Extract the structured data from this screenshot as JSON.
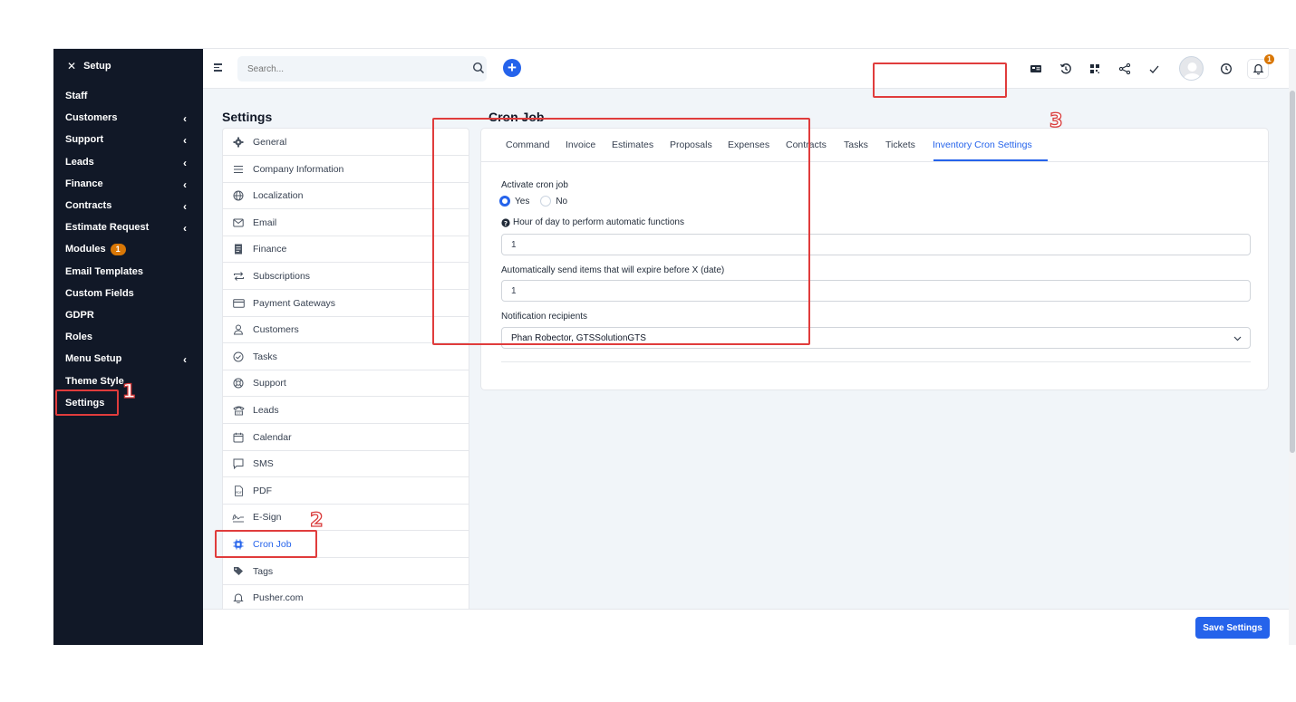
{
  "sidebar": {
    "header": "Setup",
    "items": [
      {
        "label": "Staff",
        "chevron": false
      },
      {
        "label": "Customers",
        "chevron": true
      },
      {
        "label": "Support",
        "chevron": true
      },
      {
        "label": "Leads",
        "chevron": true
      },
      {
        "label": "Finance",
        "chevron": true
      },
      {
        "label": "Contracts",
        "chevron": true
      },
      {
        "label": "Estimate Request",
        "chevron": true
      },
      {
        "label": "Modules",
        "chevron": false,
        "badge": "1"
      },
      {
        "label": "Email Templates",
        "chevron": false
      },
      {
        "label": "Custom Fields",
        "chevron": false
      },
      {
        "label": "GDPR",
        "chevron": false
      },
      {
        "label": "Roles",
        "chevron": false
      },
      {
        "label": "Menu Setup",
        "chevron": true
      },
      {
        "label": "Theme Style",
        "chevron": false
      },
      {
        "label": "Settings",
        "chevron": false,
        "highlighted": true
      }
    ]
  },
  "topbar": {
    "search_placeholder": "Search...",
    "notification_count": "1"
  },
  "settings": {
    "title": "Settings",
    "items": [
      {
        "label": "General",
        "icon": "gear-icon"
      },
      {
        "label": "Company Information",
        "icon": "lines-icon"
      },
      {
        "label": "Localization",
        "icon": "globe-icon"
      },
      {
        "label": "Email",
        "icon": "mail-icon"
      },
      {
        "label": "Finance",
        "icon": "document-icon"
      },
      {
        "label": "Subscriptions",
        "icon": "repeat-icon"
      },
      {
        "label": "Payment Gateways",
        "icon": "card-icon"
      },
      {
        "label": "Customers",
        "icon": "user-icon"
      },
      {
        "label": "Tasks",
        "icon": "check-circle-icon"
      },
      {
        "label": "Support",
        "icon": "lifebuoy-icon"
      },
      {
        "label": "Leads",
        "icon": "tty-icon"
      },
      {
        "label": "Calendar",
        "icon": "calendar-icon"
      },
      {
        "label": "SMS",
        "icon": "chat-icon"
      },
      {
        "label": "PDF",
        "icon": "pdf-icon"
      },
      {
        "label": "E-Sign",
        "icon": "signature-icon"
      },
      {
        "label": "Cron Job",
        "icon": "cpu-icon",
        "active": true
      },
      {
        "label": "Tags",
        "icon": "tag-icon"
      },
      {
        "label": "Pusher.com",
        "icon": "bell-icon"
      }
    ]
  },
  "cron": {
    "title": "Cron Job",
    "tabs": [
      "Command",
      "Invoice",
      "Estimates",
      "Proposals",
      "Expenses",
      "Contracts",
      "Tasks",
      "Tickets",
      "Inventory Cron Settings"
    ],
    "active_tab": "Inventory Cron Settings",
    "activate_label": "Activate cron job",
    "yes_label": "Yes",
    "no_label": "No",
    "activate_value": "Yes",
    "hour_label": "Hour of day to perform automatic functions",
    "hour_value": "1",
    "expire_label": "Automatically send items that will expire before X (date)",
    "expire_value": "1",
    "recipients_label": "Notification recipients",
    "recipients_value": "Phan Robector, GTSSolutionGTS"
  },
  "save_label": "Save Settings",
  "annotations": [
    "1",
    "2",
    "3"
  ],
  "colors": {
    "accent": "#2563eb",
    "sidebar": "#111827",
    "annotation": "#e03c3c",
    "badge": "#d97706"
  }
}
